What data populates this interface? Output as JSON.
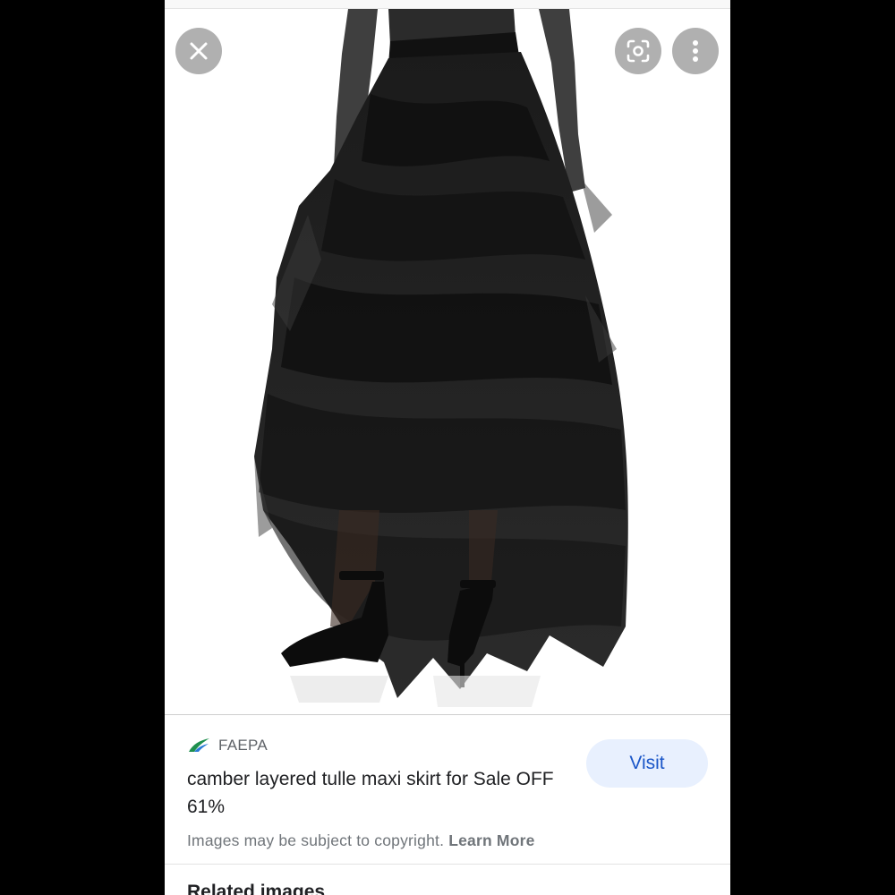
{
  "viewer": {
    "close_icon": "close-icon",
    "lens_icon": "lens-icon",
    "more_icon": "more-vertical-icon",
    "image_subject": "product-photo"
  },
  "result": {
    "source_name": "FAEPA",
    "source_logo_colors": [
      "#1e8f4e",
      "#2a7bd6"
    ],
    "title": "camber layered tulle maxi skirt for Sale OFF 61%",
    "visit_label": "Visit",
    "copyright_text": "Images may be subject to copyright.",
    "learn_more_label": "Learn More"
  },
  "related": {
    "heading": "Related images"
  },
  "colors": {
    "visit_bg": "#e8f0fe",
    "visit_text": "#1a56c8",
    "overlay_button": "#969696"
  }
}
